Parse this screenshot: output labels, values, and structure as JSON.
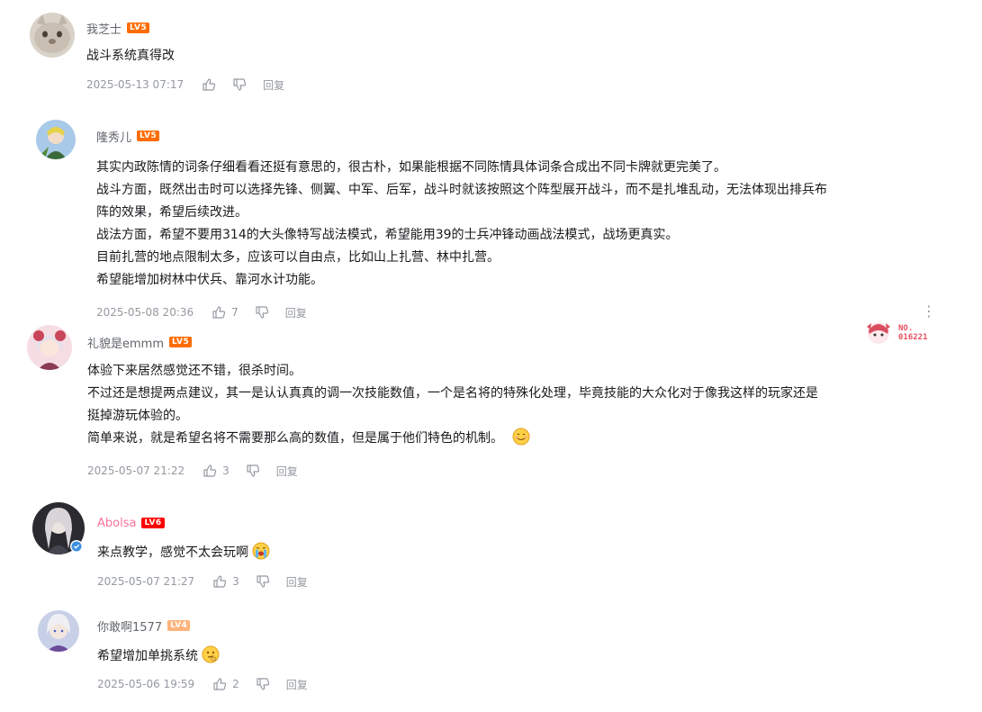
{
  "comments": [
    {
      "username": "我芝士",
      "level": "LV5",
      "level_color": "#ff6c00",
      "lines": [
        "战斗系统真得改"
      ],
      "time": "2025-05-13 07:17",
      "likes": "",
      "reply_label": "回复"
    },
    {
      "username": "隆秀儿",
      "level": "LV5",
      "level_color": "#ff6c00",
      "lines": [
        "其实内政陈情的词条仔细看看还挺有意思的，很古朴，如果能根据不同陈情具体词条合成出不同卡牌就更完美了。",
        "战斗方面，既然出击时可以选择先锋、侧翼、中军、后军，战斗时就该按照这个阵型展开战斗，而不是扎堆乱动，无法体现出排兵布",
        "阵的效果，希望后续改进。",
        "战法方面，希望不要用314的大头像特写战法模式，希望能用39的士兵冲锋动画战法模式，战场更真实。",
        "目前扎营的地点限制太多，应该可以自由点，比如山上扎营、林中扎营。",
        "希望能增加树林中伏兵、靠河水计功能。"
      ],
      "time": "2025-05-08 20:36",
      "likes": "7",
      "reply_label": "回复"
    },
    {
      "username": "礼貌是emmm",
      "level": "LV5",
      "level_color": "#ff6c00",
      "lines": [
        "体验下来居然感觉还不错，很杀时间。",
        "不过还是想提两点建议，其一是认认真真的调一次技能数值，一个是名将的特殊化处理，毕竟技能的大众化对于像我这样的玩家还是",
        "挺掉游玩体验的。",
        "简单来说，就是希望名将不需要那么高的数值，但是属于他们特色的机制。"
      ],
      "emoji": "smile-emoji",
      "time": "2025-05-07 21:22",
      "likes": "3",
      "reply_label": "回复",
      "fan_badge_number": "NO.\n016221"
    },
    {
      "username": "Abolsa",
      "level": "LV6",
      "level_color": "#ff0000",
      "name_color": "#fb7299",
      "lines": [
        "来点教学，感觉不太会玩啊"
      ],
      "emoji": "crying-emoji",
      "time": "2025-05-07 21:27",
      "likes": "3",
      "reply_label": "回复"
    },
    {
      "username": "你敢啊1577",
      "level": "LV4",
      "level_color": "#ffb37c",
      "lines": [
        "希望增加单挑系统"
      ],
      "emoji": "thinking-emoji",
      "time": "2025-05-06 19:59",
      "likes": "2",
      "reply_label": "回复"
    }
  ],
  "colors": {
    "text": "#18191c",
    "meta": "#9499a0",
    "username": "#61666d"
  }
}
